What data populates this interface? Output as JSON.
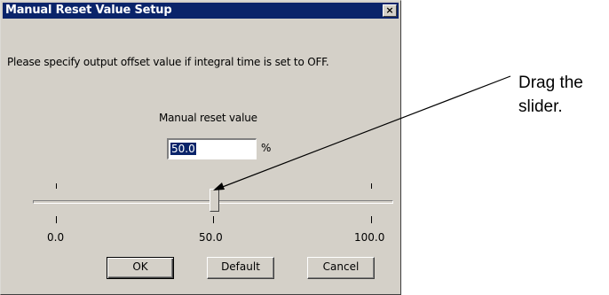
{
  "dialog": {
    "title": "Manual Reset Value Setup",
    "close_label": "×",
    "instruction": "Please specify output offset value if integral time is set to OFF.",
    "field_label": "Manual reset value",
    "field_value": "50.0",
    "unit": "%",
    "slider": {
      "min": 0,
      "max": 100,
      "value": 50,
      "min_label": "0.0",
      "mid_label": "50.0",
      "max_label": "100.0"
    },
    "buttons": {
      "ok": "OK",
      "default": "Default",
      "cancel": "Cancel"
    }
  },
  "annotation": {
    "line1": "Drag the",
    "line2": "slider."
  },
  "colors": {
    "titlebar": "#0a246a",
    "dialog_face": "#d4d0c8",
    "selection": "#0a246a"
  }
}
